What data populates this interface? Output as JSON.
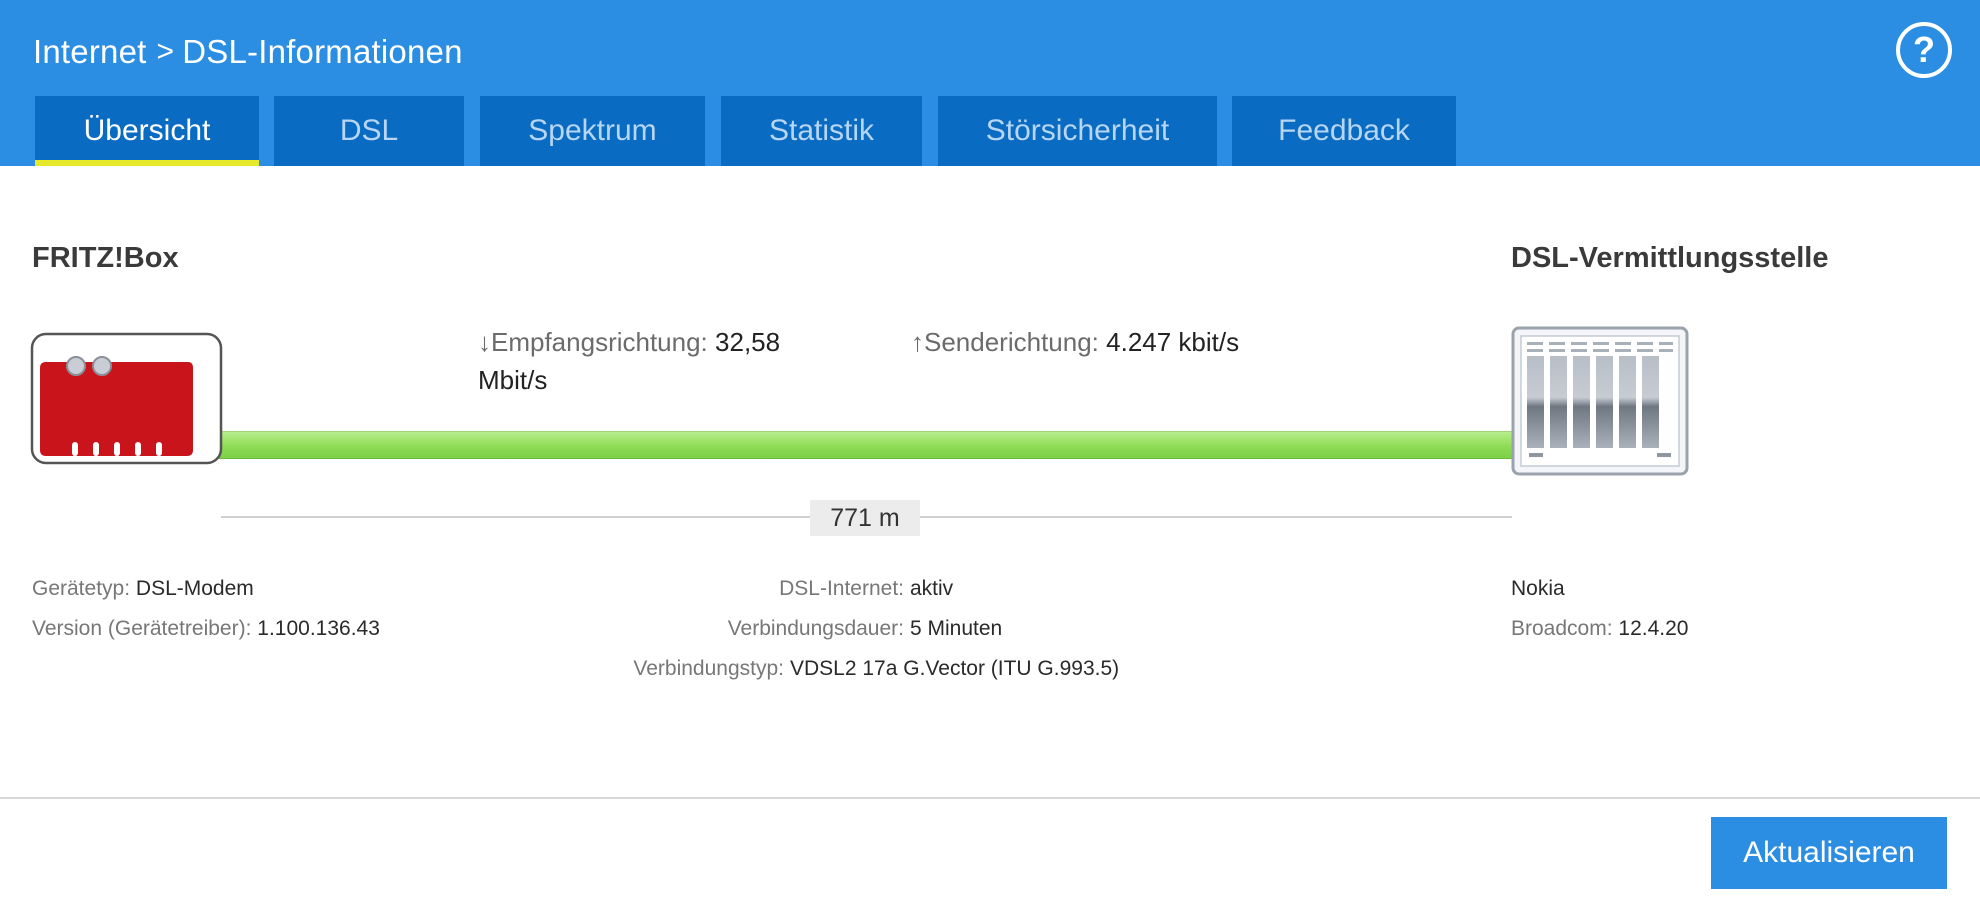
{
  "header": {
    "breadcrumb": [
      "Internet",
      "DSL-Informationen"
    ],
    "separator": ">",
    "help_label": "?"
  },
  "tabs": [
    {
      "label": "Übersicht",
      "active": true
    },
    {
      "label": "DSL",
      "active": false
    },
    {
      "label": "Spektrum",
      "active": false
    },
    {
      "label": "Statistik",
      "active": false
    },
    {
      "label": "Störsicherheit",
      "active": false
    },
    {
      "label": "Feedback",
      "active": false
    }
  ],
  "overview": {
    "left_device": "FRITZ!Box",
    "right_device": "DSL-Vermittlungsstelle",
    "downstream": {
      "arrow": "↓",
      "label": "Empfangsrichtung:",
      "value_line1": "32,58",
      "value_line2": "Mbit/s"
    },
    "upstream": {
      "arrow": "↑",
      "label": "Senderichtung:",
      "value": "4.247 kbit/s"
    },
    "distance": "771 m"
  },
  "info": {
    "left": [
      {
        "label": "Gerätetyp:",
        "value": "DSL-Modem"
      },
      {
        "label": "Version (Gerätetreiber):",
        "value": "1.100.136.43"
      }
    ],
    "center": [
      {
        "label": "DSL-Internet:",
        "value": "aktiv"
      },
      {
        "label": "Verbindungsdauer:",
        "value": "5 Minuten"
      },
      {
        "label": "Verbindungstyp:",
        "value": "VDSL2 17a G.Vector (ITU G.993.5)"
      }
    ],
    "right": [
      {
        "label": "",
        "value": "Nokia"
      },
      {
        "label": "Broadcom:",
        "value": "12.4.20"
      }
    ]
  },
  "footer": {
    "refresh_label": "Aktualisieren"
  },
  "colors": {
    "header": "#2b8ee3",
    "tab": "#0a6bc2",
    "tab_active_underline": "#e6ea2a",
    "line": "#8fdc55",
    "router_red": "#c8141a"
  }
}
